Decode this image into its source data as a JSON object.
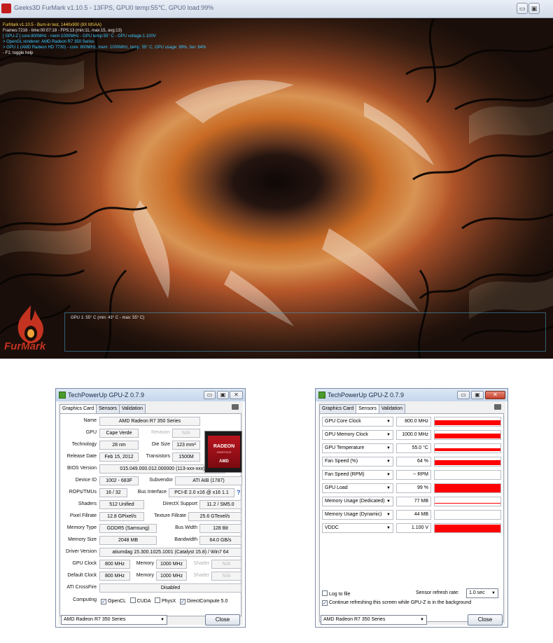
{
  "furmark": {
    "title": "Geeks3D FurMark v1.10.5 - 13FPS, GPU0 temp:55℃, GPU0 load:99%",
    "overlay": [
      "FurMark v1.10.5 - Burn-in test, 1440x900 (8X MSAA)",
      "Frames:7216 - time:00:07:18 - FPS:13 (min:11, max:15, avg:13)",
      "[ GPU-Z ] core:800MHz - mem:1000MHz - GPU temp:55° C - GPU voltage:1.100V",
      "> OpenGL renderer: AMD Radeon R7 350 Series",
      "> GPU 1 (AMD Radeon HD 7730) - core: 800MHz, mem: 1000MHz, temp: 55° C, GPU usage: 99%, fan: 64%",
      "- F1: toggle help"
    ],
    "graph_label": "GPU 1: 55° C (min: 43° C - max: 55° C)",
    "logo_text": "FurMark"
  },
  "gpuz_left": {
    "title": "TechPowerUp GPU-Z 0.7.9",
    "tabs": [
      "Graphics Card",
      "Sensors",
      "Validation"
    ],
    "active_tab": "Graphics Card",
    "fields": {
      "name_label": "Name",
      "name": "AMD Radeon R7 350 Series",
      "gpu_label": "GPU",
      "gpu": "Cape Verde",
      "revision_label": "Revision",
      "revision": "N/A",
      "technology_label": "Technology",
      "technology": "28 nm",
      "die_size_label": "Die Size",
      "die_size": "123 mm²",
      "release_label": "Release Date",
      "release": "Feb 15, 2012",
      "transistors_label": "Transistors",
      "transistors": "1500M",
      "bios_label": "BIOS Version",
      "bios": "015.049.000.012.000000 (113-xxx-xxx)",
      "device_label": "Device ID",
      "device": "1002 - 683F",
      "subvendor_label": "Subvendor",
      "subvendor": "ATI AIB (1787)",
      "rops_label": "ROPs/TMUs",
      "rops": "16 / 32",
      "bus_label": "Bus Interface",
      "bus": "PCI-E 2.0 x16 @ x16 1.1",
      "shaders_label": "Shaders",
      "shaders": "512 Unified",
      "directx_label": "DirectX Support",
      "directx": "11.2 / SM5.0",
      "pixel_label": "Pixel Fillrate",
      "pixel": "12.8 GPixel/s",
      "texture_label": "Texture Fillrate",
      "texture": "25.6 GTexel/s",
      "memtype_label": "Memory Type",
      "memtype": "GDDR5 (Samsung)",
      "buswidth_label": "Bus Width",
      "buswidth": "128 Bit",
      "memsize_label": "Memory Size",
      "memsize": "2048 MB",
      "bandwidth_label": "Bandwidth",
      "bandwidth": "64.0 GB/s",
      "driver_label": "Driver Version",
      "driver": "atiumdag 15.300.1025.1001 (Catalyst 15.8) / Win7 64",
      "gpuclock_label": "GPU Clock",
      "gpuclock": "800 MHz",
      "memory_label": "Memory",
      "memclock": "1000 MHz",
      "shader_label": "Shader",
      "shader": "N/A",
      "defclock_label": "Default Clock",
      "defclock": "800 MHz",
      "defmem": "1000 MHz",
      "defshader": "N/A",
      "crossfire_label": "ATI CrossFire",
      "crossfire": "Disabled",
      "computing_label": "Computing",
      "opencl": "OpenCL",
      "cuda": "CUDA",
      "physx": "PhysX",
      "directcompute": "DirectCompute 5.0"
    },
    "amd_logo": {
      "line1": "RADEON",
      "line2": "GRAPHICS",
      "line3": "AMD"
    },
    "card_select": "AMD Radeon R7 350 Series",
    "close": "Close",
    "min_btn": "▭",
    "max_btn": "▣",
    "close_btn": "✕"
  },
  "gpuz_right": {
    "title": "TechPowerUp GPU-Z 0.7.9",
    "tabs": [
      "Graphics Card",
      "Sensors",
      "Validation"
    ],
    "active_tab": "Sensors",
    "sensors": [
      {
        "name": "GPU Core Clock",
        "value": "800.0 MHz",
        "level": 0.55
      },
      {
        "name": "GPU Memory Clock",
        "value": "1000.0 MHz",
        "level": 0.55
      },
      {
        "name": "GPU Temperature",
        "value": "55.0 °C",
        "level": 0.35
      },
      {
        "name": "Fan Speed (%)",
        "value": "64 %",
        "level": 0.55
      },
      {
        "name": "Fan Speed (RPM)",
        "value": "-- RPM",
        "level": 0
      },
      {
        "name": "GPU Load",
        "value": "99 %",
        "level": 0.99
      },
      {
        "name": "Memory Usage (Dedicated)",
        "value": "77 MB",
        "level": 0.06
      },
      {
        "name": "Memory Usage (Dynamic)",
        "value": "44 MB",
        "level": 0.0
      },
      {
        "name": "VDDC",
        "value": "1.100 V",
        "level": 0.95
      }
    ],
    "log_to_file": "Log to file",
    "refresh_label": "Sensor refresh rate:",
    "refresh_value": "1.0 sec",
    "continue_label": "Continue refreshing this screen while GPU-Z is in the background",
    "card_select": "AMD Radeon R7 350 Series",
    "close": "Close",
    "min_btn": "▭",
    "max_btn": "▣",
    "close_btn": "✕"
  },
  "colors": {
    "sensor_bar": "#ff0000",
    "furmark_orange": "#d4761f"
  }
}
